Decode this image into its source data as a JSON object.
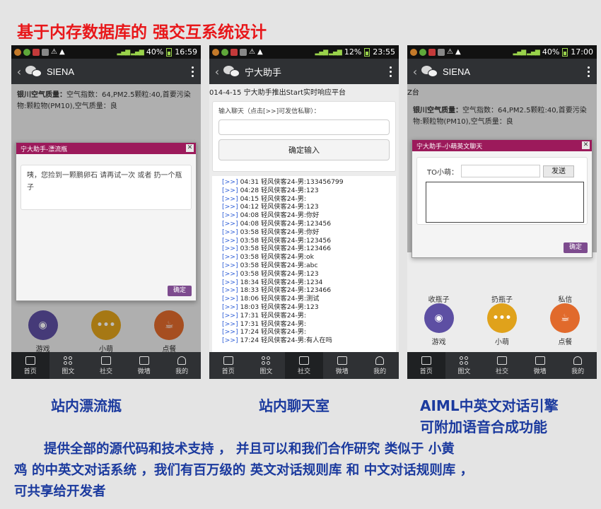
{
  "title": "基于内存数据库的 强交互系统设计",
  "phones": [
    {
      "status": {
        "battery": "40%",
        "time": "16:59"
      },
      "action_title": "SIENA",
      "aqi_label": "银川空气质量：",
      "aqi_text": "空气指数：64,PM2.5颗粒:40,首要污染物:颗粒物(PM10),空气质量：良",
      "dialog_title": "宁大助手-漂流瓶",
      "dialog_close": "✕",
      "dialog_message": "咦，您捡到一颗鹏卵石 请再试一次 或者 扔一个瓶子",
      "dialog_ok": "确定",
      "icons": [
        {
          "label": "游戏",
          "color": "#5d4fa3",
          "glyph": "◉"
        },
        {
          "label": "小萌",
          "color": "#e0a21b",
          "glyph": "•••"
        },
        {
          "label": "点餐",
          "color": "#e16a2c",
          "glyph": "☕"
        }
      ]
    },
    {
      "status": {
        "battery": "12%",
        "time": "23:55"
      },
      "action_title": "宁大助手",
      "header_text": "014-4-15 宁大助手推出Start实时响应平台",
      "form_label": "输入聊天（点击[>>]可发信私聊）：",
      "submit_label": "确定输入",
      "link_text": "[>>]",
      "log": [
        "04:31 轻风侠客24-男:133456799",
        "04:28 轻风侠客24-男:123",
        "04:15 轻风侠客24-男:",
        "04:12 轻风侠客24-男:123",
        "04:08 轻风侠客24-男:你好",
        "04:08 轻风侠客24-男:123456",
        "03:58 轻风侠客24-男:你好",
        "03:58 轻风侠客24-男:123456",
        "03:58 轻风侠客24-男:123466",
        "03:58 轻风侠客24-男:ok",
        "03:58 轻风侠客24-男:abc",
        "03:58 轻风侠客24-男:123",
        "18:34 轻风侠客24-男:1234",
        "18:33 轻风侠客24-男:123466",
        "18:06 轻风侠客24-男:测试",
        "18:03 轻风侠客24-男:123",
        "17:31 轻风侠客24-男:",
        "17:31 轻风侠客24-男:",
        "17:24 轻风侠客24-男:",
        "17:24 轻风侠客24-男:有人在吗"
      ]
    },
    {
      "status": {
        "battery": "40%",
        "time": "17:00"
      },
      "action_title": "SIENA",
      "header_text": "Z台",
      "aqi_label": "银川空气质量：",
      "aqi_text": "空气指数：64,PM2.5颗粒:40,首要污染物:颗粒物(PM10),空气质量：良",
      "dialog_title": "宁大助手-小萌英文聊天",
      "dialog_close": "✕",
      "to_label": "TO小萌：",
      "send_label": "发送",
      "dialog_ok": "确定",
      "behind_labels": [
        "收瓶子",
        "扔瓶子",
        "私信"
      ],
      "icons": [
        {
          "label": "游戏",
          "color": "#5d4fa3",
          "glyph": "◉"
        },
        {
          "label": "小萌",
          "color": "#e0a21b",
          "glyph": "•••"
        },
        {
          "label": "点餐",
          "color": "#e16a2c",
          "glyph": "☕"
        }
      ]
    }
  ],
  "tabs": [
    {
      "label": "首页",
      "icon": "home-icon"
    },
    {
      "label": "图文",
      "icon": "grid-icon"
    },
    {
      "label": "社交",
      "icon": "social-icon"
    },
    {
      "label": "微墙",
      "icon": "wall-icon"
    },
    {
      "label": "我的",
      "icon": "profile-icon"
    }
  ],
  "captions": [
    "站内漂流瓶",
    "站内聊天室",
    "AIML中英文对话引擎",
    "可附加语音合成功能"
  ],
  "description": [
    "提供全部的源代码和技术支持 ， 并且可以和我们合作研究 类似于 小黄",
    "鸡 的中英文对话系统 ，我们有百万级的 英文对话规则库 和 中文对话规则库 ，",
    "可共享给开发者"
  ]
}
